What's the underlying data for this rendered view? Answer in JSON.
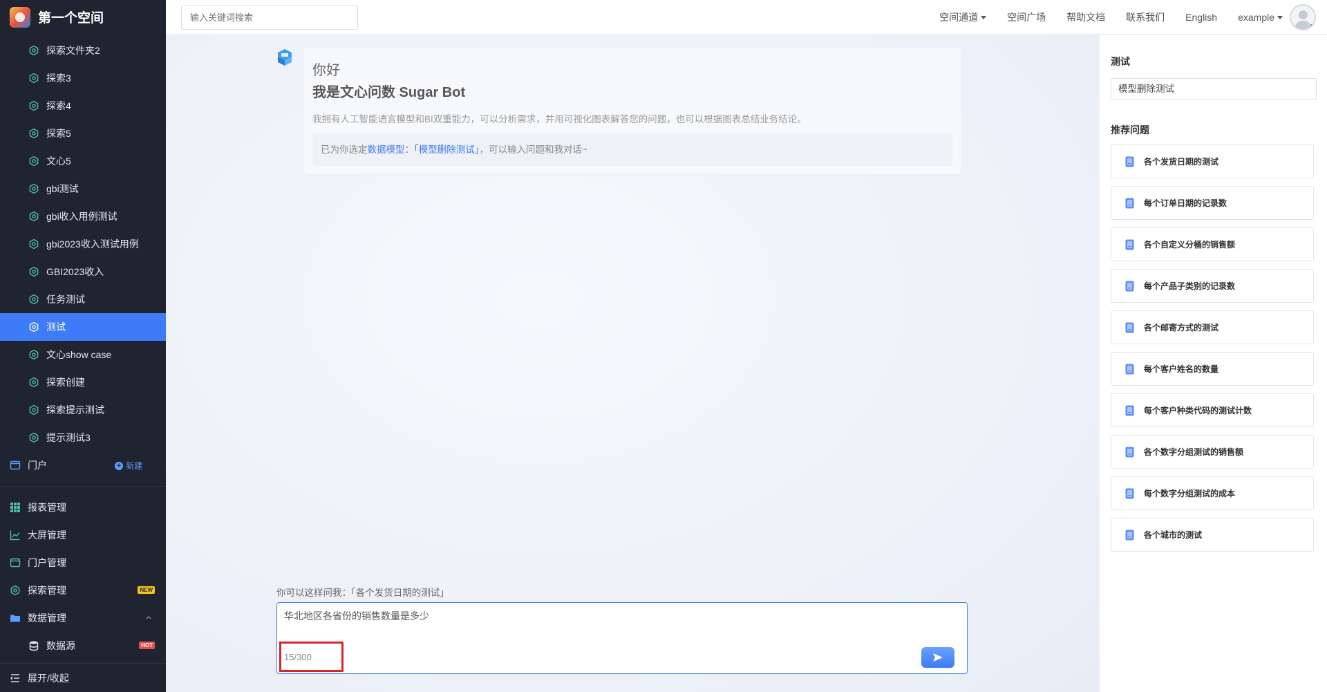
{
  "brand": {
    "title": "第一个空间"
  },
  "sidebar": {
    "tree": [
      {
        "label": "探索文件夹2",
        "active": false
      },
      {
        "label": "探索3",
        "active": false
      },
      {
        "label": "探索4",
        "active": false
      },
      {
        "label": "探索5",
        "active": false
      },
      {
        "label": "文心5",
        "active": false
      },
      {
        "label": "gbi测试",
        "active": false
      },
      {
        "label": "gbi收入用例测试",
        "active": false
      },
      {
        "label": "gbi2023收入测试用例",
        "active": false
      },
      {
        "label": "GBI2023收入",
        "active": false
      },
      {
        "label": "任务测试",
        "active": false
      },
      {
        "label": "测试",
        "active": true
      },
      {
        "label": "文心show case",
        "active": false
      },
      {
        "label": "探索创建",
        "active": false
      },
      {
        "label": "探索提示测试",
        "active": false
      },
      {
        "label": "提示测试3",
        "active": false
      }
    ],
    "portal": {
      "label": "门户",
      "new_label": "新建"
    },
    "menu": [
      {
        "label": "报表管理",
        "icon": "grid-icon"
      },
      {
        "label": "大屏管理",
        "icon": "line-chart-icon"
      },
      {
        "label": "门户管理",
        "icon": "window-icon"
      },
      {
        "label": "探索管理",
        "icon": "hexagon-icon",
        "badge": "NEW"
      },
      {
        "label": "数据管理",
        "icon": "folder-icon"
      }
    ],
    "submenu": {
      "label": "数据源",
      "badge": "HOT"
    },
    "collapse_label": "展开/收起"
  },
  "topbar": {
    "search_placeholder": "输入关键词搜索",
    "nav": {
      "space_channel": "空间通道",
      "space_square": "空间广场",
      "help_docs": "帮助文档",
      "contact": "联系我们",
      "language": "English",
      "user": "example"
    }
  },
  "chat": {
    "hello": "你好",
    "bot_name": "我是文心问数 Sugar Bot",
    "description": "我拥有人工智能语言模型和BI双重能力，可以分析需求，并用可视化图表解答您的问题，也可以根据图表总结业务结论。",
    "selected_prefix": "已为你选定",
    "selected_link": "数据模型：「模型删除测试」",
    "selected_suffix": "，可以输入问题和我对话~",
    "hint": "你可以这样问我：「各个发货日期的测试」",
    "input_text": "华北地区各省份的销售数量是多少",
    "counter": "15/300"
  },
  "right_panel": {
    "title": "测试",
    "model_value": "模型删除测试",
    "recommend_title": "推荐问题",
    "questions": [
      "各个发货日期的测试",
      "每个订单日期的记录数",
      "各个自定义分桶的销售额",
      "每个产品子类别的记录数",
      "各个邮寄方式的测试",
      "每个客户姓名的数量",
      "每个客户种类代码的测试计数",
      "各个数字分组测试的销售额",
      "每个数字分组测试的成本",
      "各个城市的测试"
    ]
  },
  "colors": {
    "accent": "#3d7bf7",
    "sidebar_bg": "#1f2430",
    "highlight_box": "#d9232d"
  }
}
